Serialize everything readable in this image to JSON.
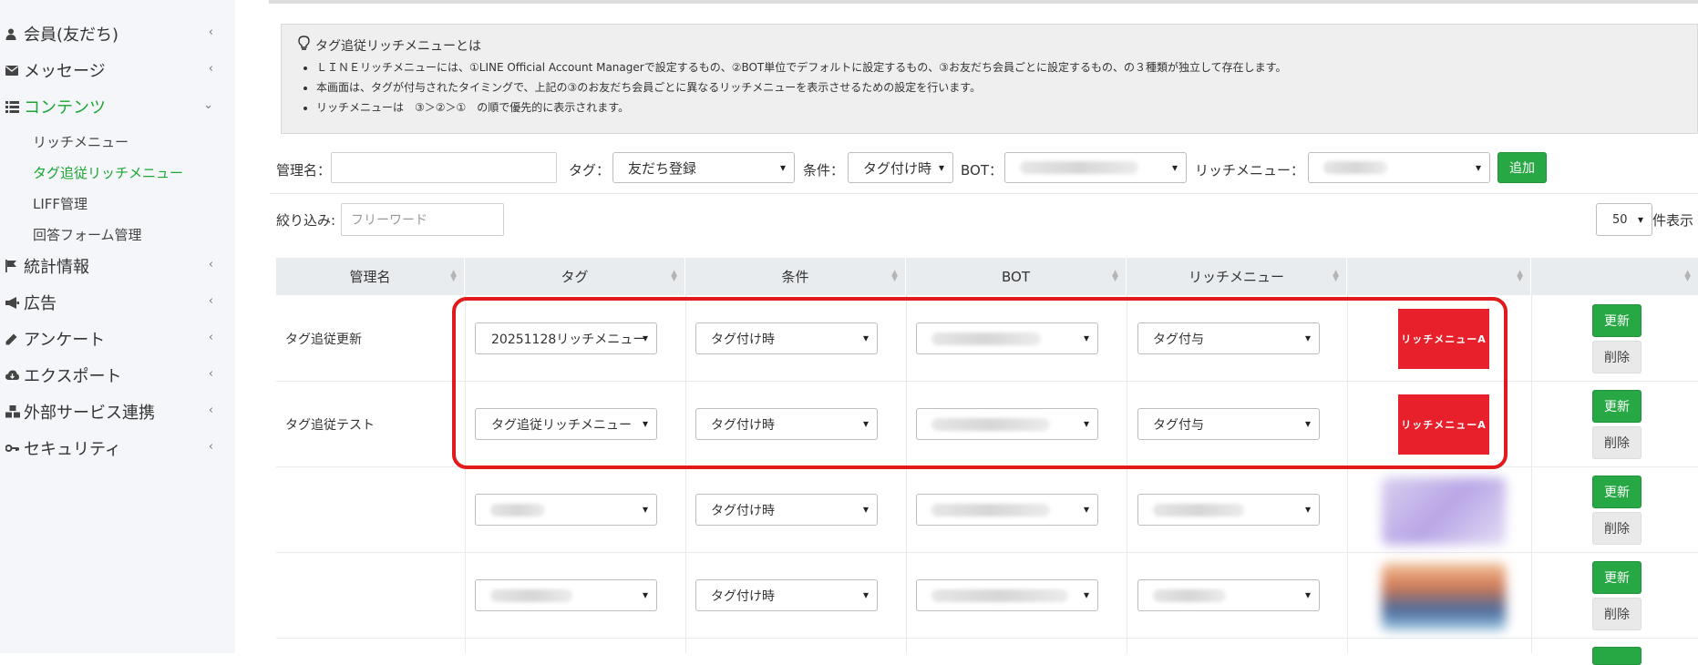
{
  "sidebar": {
    "items": [
      {
        "label": "会員(友だち)",
        "icon": "user-icon"
      },
      {
        "label": "メッセージ",
        "icon": "envelope-icon"
      },
      {
        "label": "コンテンツ",
        "icon": "list-icon"
      },
      {
        "label": "統計情報",
        "icon": "flag-icon"
      },
      {
        "label": "広告",
        "icon": "megaphone-icon"
      },
      {
        "label": "アンケート",
        "icon": "pencil-icon"
      },
      {
        "label": "エクスポート",
        "icon": "cloud-download-icon"
      },
      {
        "label": "外部サービス連携",
        "icon": "cubes-icon"
      },
      {
        "label": "セキュリティ",
        "icon": "key-icon"
      }
    ],
    "sub_items": [
      {
        "label": "リッチメニュー"
      },
      {
        "label": "タグ追従リッチメニュー"
      },
      {
        "label": "LIFF管理"
      },
      {
        "label": "回答フォーム管理"
      }
    ],
    "colors": {
      "active": "#19a531"
    }
  },
  "info": {
    "title": "タグ追従リッチメニューとは",
    "lines": [
      "ＬＩＮＥリッチメニューには、①LINE Official Account Managerで設定するもの、②BOT単位でデフォルトに設定するもの、③お友だち会員ごとに設定するもの、の３種類が独立して存在します。",
      "本画面は、タグが付与されたタイミングで、上記の③のお友だち会員ごとに異なるリッチメニューを表示させるための設定を行います。",
      "リッチメニューは　③＞②＞①　の順で優先的に表示されます。"
    ]
  },
  "form": {
    "name_label": "管理名：",
    "tag_label": "タグ：",
    "tag_value": "友だち登録",
    "cond_label": "条件：",
    "cond_value": "タグ付け時",
    "bot_label": "BOT：",
    "rich_label": "リッチメニュー：",
    "add_button": "追加"
  },
  "filter": {
    "label": "絞り込み:",
    "placeholder": "フリーワード",
    "page_size": "50",
    "page_suffix": "件表示"
  },
  "table": {
    "headers": [
      "管理名",
      "タグ",
      "条件",
      "BOT",
      "リッチメニュー",
      "",
      ""
    ],
    "update_label": "更新",
    "delete_label": "削除",
    "rows": [
      {
        "name": "タグ追従更新",
        "tag": "20251128リッチメニュー",
        "condition": "タグ付け時",
        "trigger": "タグ付与",
        "thumb_text": "リッチメニューA"
      },
      {
        "name": "タグ追従テスト",
        "tag": "タグ追従リッチメニュー",
        "condition": "タグ付け時",
        "trigger": "タグ付与",
        "thumb_text": "リッチメニューA"
      },
      {
        "name": "",
        "tag": "",
        "condition": "タグ付け時",
        "trigger": "",
        "thumb_text": ""
      },
      {
        "name": "",
        "tag": "",
        "condition": "タグ付け時",
        "trigger": "",
        "thumb_text": ""
      }
    ]
  },
  "colors": {
    "primary": "#28a745",
    "highlight": "#e11b1b",
    "thumb": "#e8202c"
  }
}
